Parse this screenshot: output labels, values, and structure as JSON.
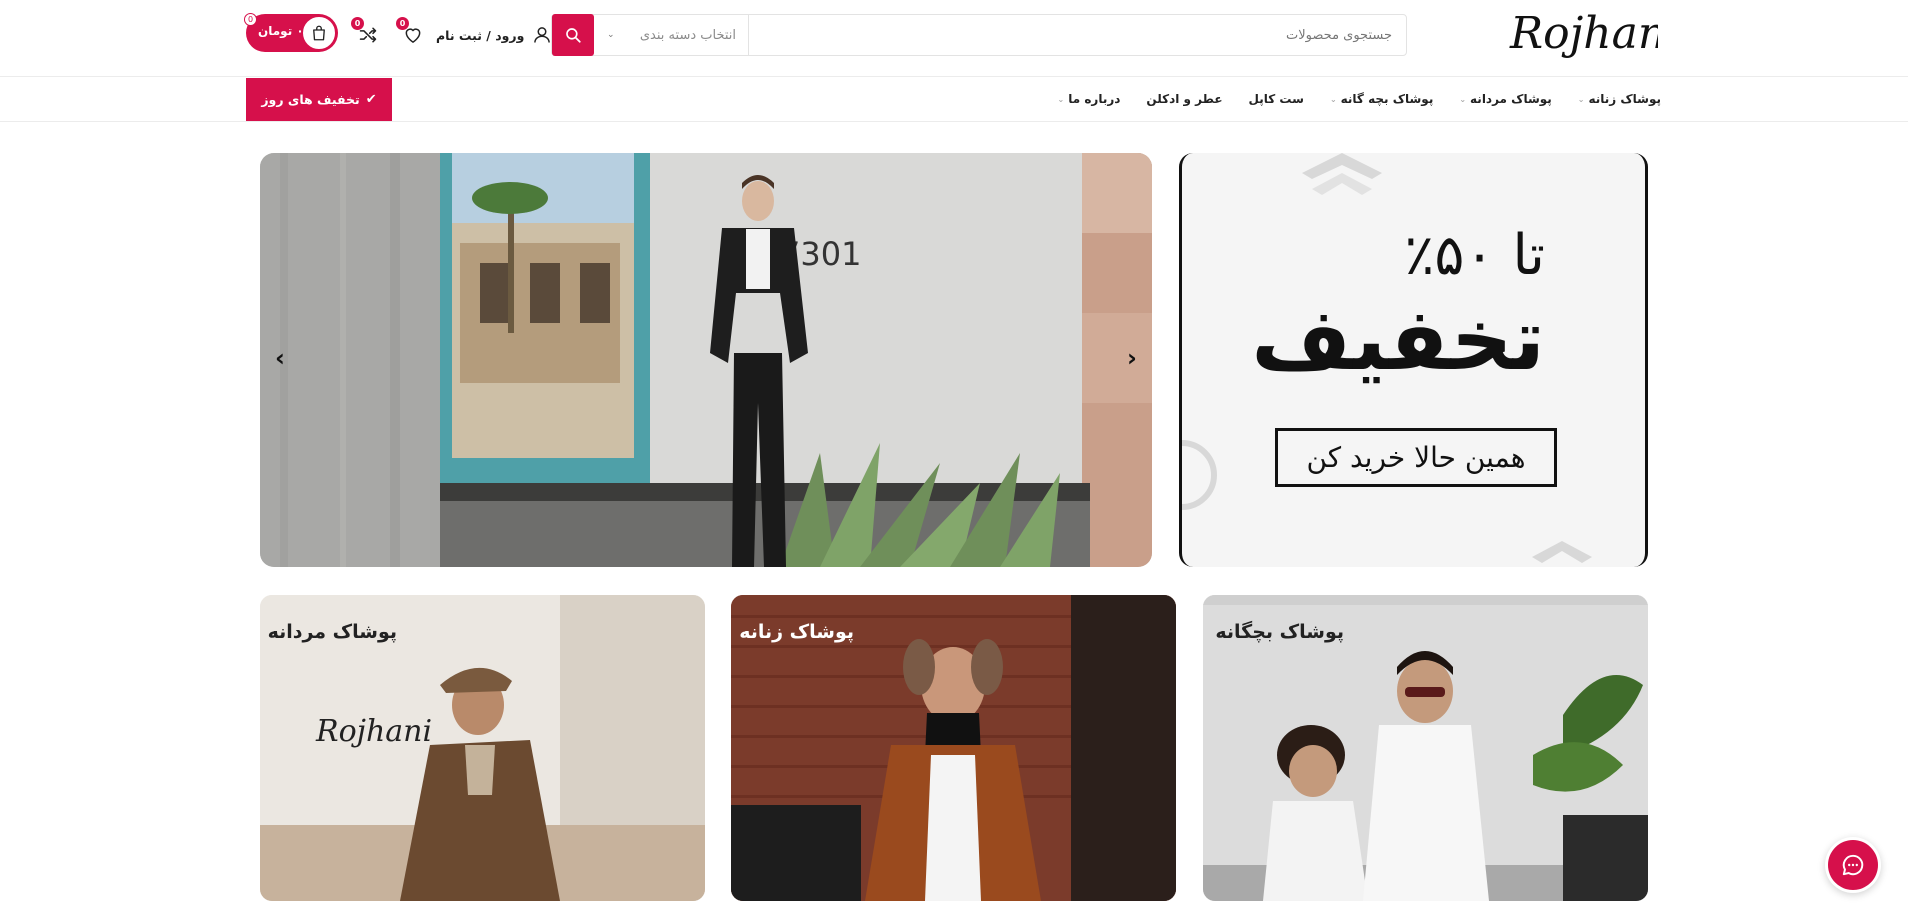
{
  "brand": {
    "logo_text": "Rojhani"
  },
  "header": {
    "search": {
      "placeholder": "جستجوی محصولات",
      "category_placeholder": "انتخاب دسته بندی"
    },
    "account_label": "ورود / ثبت نام",
    "wishlist_count": "0",
    "compare_count": "0",
    "cart": {
      "total": "۰ تومان",
      "count": "0"
    }
  },
  "nav": {
    "items": [
      {
        "label": "پوشاک زنانه",
        "has_dropdown": true
      },
      {
        "label": "پوشاک مردانه",
        "has_dropdown": true
      },
      {
        "label": "پوشاک بچه گانه",
        "has_dropdown": true
      },
      {
        "label": "ست کاپل",
        "has_dropdown": false
      },
      {
        "label": "عطر و ادکلن",
        "has_dropdown": false
      },
      {
        "label": "درباره ما",
        "has_dropdown": true
      }
    ],
    "deals_label": "تخفیف های روز"
  },
  "hero": {
    "house_number": "7301"
  },
  "promo": {
    "line1": "تا ۵۰٪",
    "line2": "تخفیف",
    "cta": "همین حالا خرید کن"
  },
  "categories": [
    {
      "title": "پوشاک مردانه",
      "watermark": "Rojhani"
    },
    {
      "title": "پوشاک زنانه"
    },
    {
      "title": "پوشاک بچگانه"
    }
  ],
  "colors": {
    "accent": "#d6104b"
  }
}
